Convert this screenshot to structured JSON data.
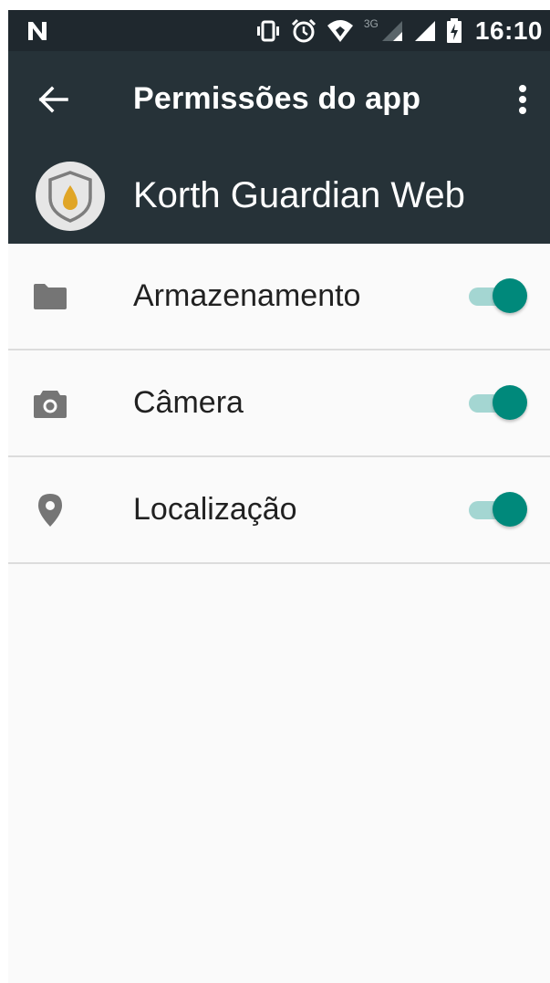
{
  "status_bar": {
    "network_label": "3G",
    "time": "16:10"
  },
  "toolbar": {
    "title": "Permissões do app"
  },
  "app": {
    "name": "Korth Guardian Web"
  },
  "permissions": [
    {
      "label": "Armazenamento",
      "icon": "folder-icon",
      "enabled": true
    },
    {
      "label": "Câmera",
      "icon": "camera-icon",
      "enabled": true
    },
    {
      "label": "Localização",
      "icon": "location-pin-icon",
      "enabled": true
    }
  ],
  "colors": {
    "status_bar_bg": "#1f282e",
    "toolbar_bg": "#263238",
    "background": "#fafafa",
    "accent": "#00897b",
    "switch_track": "#a4d6d2",
    "logo_drop": "#e0a526"
  }
}
